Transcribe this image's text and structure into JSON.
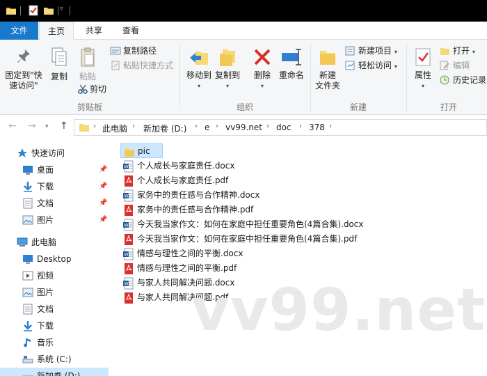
{
  "tabs": {
    "file": "文件",
    "home": "主页",
    "share": "共享",
    "view": "查看"
  },
  "ribbon": {
    "clipboard": {
      "pin": "固定到\"快\n速访问\"",
      "copy": "复制",
      "paste": "粘贴",
      "copy_path": "复制路径",
      "paste_shortcut": "粘贴快捷方式",
      "cut": "剪切",
      "group": "剪贴板"
    },
    "organize": {
      "move_to": "移动到",
      "copy_to": "复制到",
      "delete": "删除",
      "rename": "重命名",
      "group": "组织"
    },
    "new": {
      "new_folder": "新建\n文件夹",
      "new_item": "新建项目",
      "easy_access": "轻松访问",
      "group": "新建"
    },
    "open": {
      "properties": "属性",
      "open": "打开",
      "edit": "编辑",
      "history": "历史记录",
      "group": "打开"
    }
  },
  "address": {
    "crumbs": [
      "此电脑",
      "新加卷 (D:)",
      "e",
      "vv99.net",
      "doc",
      "378"
    ]
  },
  "nav": {
    "quick_access": "快速访问",
    "quick": [
      {
        "label": "桌面",
        "icon": "desktop-icon"
      },
      {
        "label": "下载",
        "icon": "download-icon"
      },
      {
        "label": "文档",
        "icon": "document-icon"
      },
      {
        "label": "图片",
        "icon": "picture-icon"
      }
    ],
    "this_pc": "此电脑",
    "pc": [
      {
        "label": "Desktop",
        "icon": "desktop-icon"
      },
      {
        "label": "视频",
        "icon": "video-icon"
      },
      {
        "label": "图片",
        "icon": "picture-icon"
      },
      {
        "label": "文档",
        "icon": "document-icon"
      },
      {
        "label": "下载",
        "icon": "download-icon"
      },
      {
        "label": "音乐",
        "icon": "music-icon"
      },
      {
        "label": "系统 (C:)",
        "icon": "drive-icon"
      },
      {
        "label": "新加卷 (D:)",
        "icon": "drive-icon"
      }
    ]
  },
  "files": [
    {
      "name": "pic",
      "type": "folder"
    },
    {
      "name": "个人成长与家庭责任.docx",
      "type": "docx"
    },
    {
      "name": "个人成长与家庭责任.pdf",
      "type": "pdf"
    },
    {
      "name": "家务中的责任感与合作精神.docx",
      "type": "docx"
    },
    {
      "name": "家务中的责任感与合作精神.pdf",
      "type": "pdf"
    },
    {
      "name": "今天我当家作文：如何在家庭中担任重要角色(4篇合集).docx",
      "type": "docx"
    },
    {
      "name": "今天我当家作文：如何在家庭中担任重要角色(4篇合集).pdf",
      "type": "pdf"
    },
    {
      "name": "情感与理性之间的平衡.docx",
      "type": "docx"
    },
    {
      "name": "情感与理性之间的平衡.pdf",
      "type": "pdf"
    },
    {
      "name": "与家人共同解决问题.docx",
      "type": "docx"
    },
    {
      "name": "与家人共同解决问题.pdf",
      "type": "pdf"
    }
  ],
  "watermark": "vv99.net",
  "colors": {
    "file_tab": "#1979ca",
    "selection": "#cce8ff",
    "folder": "#f8d775",
    "pdf": "#d9302e",
    "word": "#2b5797"
  }
}
